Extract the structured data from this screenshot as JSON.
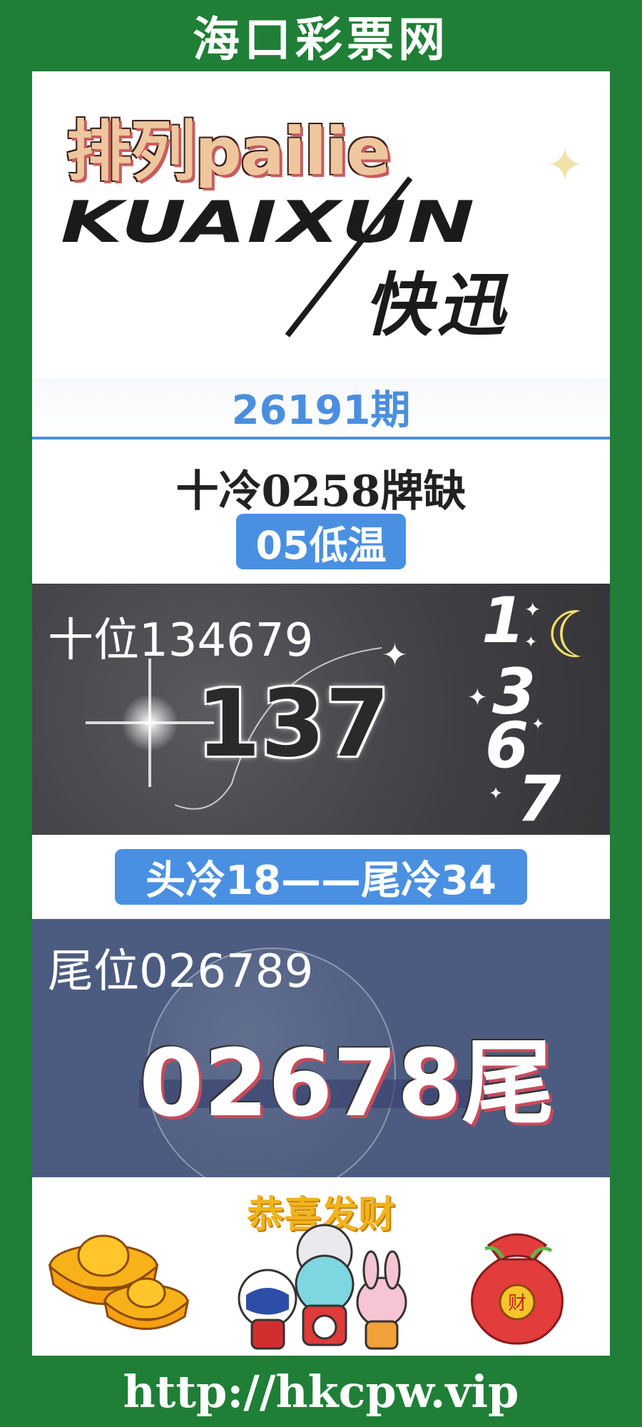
{
  "site_title": "海口彩票网",
  "logo": {
    "brand_cn": "排列pailie",
    "brand_en": "KUAIXUN",
    "brand_sub": "快迅"
  },
  "issue": "26191期",
  "tens_cold": "十冷0258牌缺",
  "temperature": "05低温",
  "tens_section": {
    "label": "十位134679",
    "pick": "137",
    "side_digits": [
      "1",
      "3",
      "6",
      "7"
    ]
  },
  "head_tail": "头冷18——尾冷34",
  "units_section": {
    "label": "尾位026789",
    "pick": "02678尾"
  },
  "congrats": "恭喜发财",
  "bag_char": "财",
  "footer_url": "http://hkcpw.vip",
  "colors": {
    "background": "#1f7f36",
    "accent_blue": "#4a90e2",
    "tens_bg": "#3f3f44",
    "units_bg": "#4c5c80",
    "gold": "#f0b41c"
  }
}
